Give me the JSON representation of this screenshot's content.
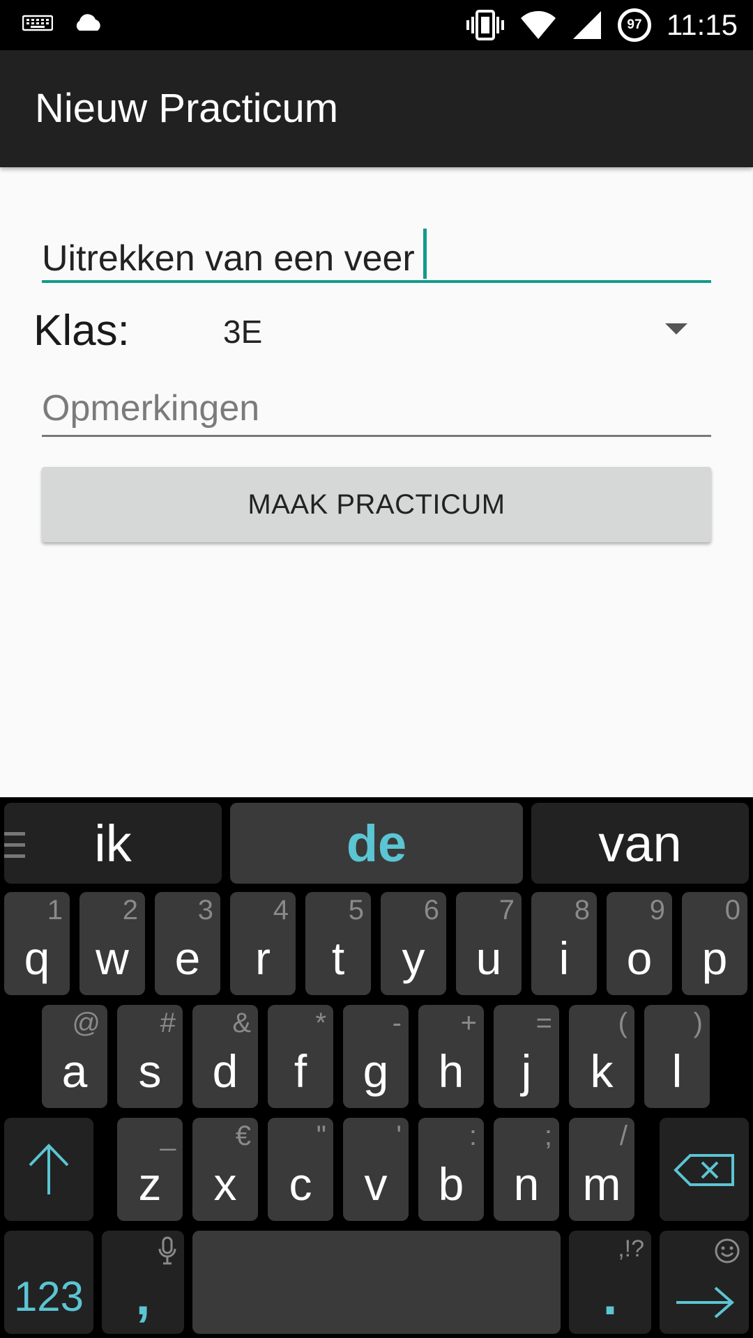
{
  "status_bar": {
    "time": "11:15",
    "battery_percent": "97",
    "icons": [
      "keyboard-icon",
      "cloud-icon",
      "vibrate-icon",
      "wifi-icon",
      "cell-signal-icon",
      "battery-icon"
    ]
  },
  "app_bar": {
    "title": "Nieuw Practicum"
  },
  "form": {
    "title_value": "Uitrekken van een veer",
    "klas_label": "Klas:",
    "klas_value": "3E",
    "opmerkingen_placeholder": "Opmerkingen",
    "submit_label": "MAAK PRACTICUM"
  },
  "keyboard": {
    "suggestions": [
      "ik",
      "de",
      "van"
    ],
    "row1": [
      {
        "key": "q",
        "hint": "1"
      },
      {
        "key": "w",
        "hint": "2"
      },
      {
        "key": "e",
        "hint": "3"
      },
      {
        "key": "r",
        "hint": "4"
      },
      {
        "key": "t",
        "hint": "5"
      },
      {
        "key": "y",
        "hint": "6"
      },
      {
        "key": "u",
        "hint": "7"
      },
      {
        "key": "i",
        "hint": "8"
      },
      {
        "key": "o",
        "hint": "9"
      },
      {
        "key": "p",
        "hint": "0"
      }
    ],
    "row2": [
      {
        "key": "a",
        "hint": "@"
      },
      {
        "key": "s",
        "hint": "#"
      },
      {
        "key": "d",
        "hint": "&"
      },
      {
        "key": "f",
        "hint": "*"
      },
      {
        "key": "g",
        "hint": "-"
      },
      {
        "key": "h",
        "hint": "+"
      },
      {
        "key": "j",
        "hint": "="
      },
      {
        "key": "k",
        "hint": "("
      },
      {
        "key": "l",
        "hint": ")"
      }
    ],
    "row3": [
      {
        "key": "z",
        "hint": "_"
      },
      {
        "key": "x",
        "hint": "€"
      },
      {
        "key": "c",
        "hint": "\""
      },
      {
        "key": "v",
        "hint": "'"
      },
      {
        "key": "b",
        "hint": ":"
      },
      {
        "key": "n",
        "hint": ";"
      },
      {
        "key": "m",
        "hint": "/"
      }
    ],
    "numbers_label": "123",
    "comma_label": ",",
    "period_label": ".",
    "period_hint": ",!?",
    "accent_color": "#5bc5d3"
  }
}
